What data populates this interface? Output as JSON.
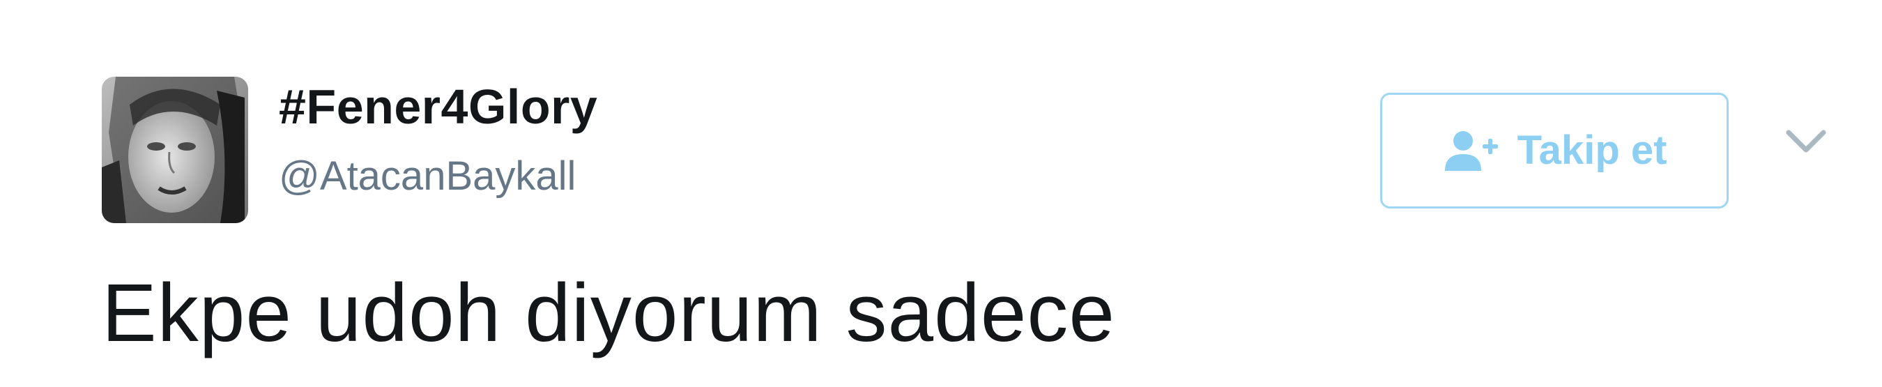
{
  "tweet": {
    "author": {
      "display_name": "#Fener4Glory",
      "handle": "@AtacanBaykall",
      "avatar_icon": "profile-photo"
    },
    "follow_button": {
      "label": "Takip et",
      "icon": "add-user-icon"
    },
    "more_menu_icon": "chevron-down-icon",
    "text": "Ekpe udoh diyorum sadece"
  },
  "colors": {
    "name": "#14171a",
    "handle": "#657786",
    "follow_border": "#a0d6f5",
    "follow_text": "#8ccff3",
    "caret": "#aab8c2"
  }
}
